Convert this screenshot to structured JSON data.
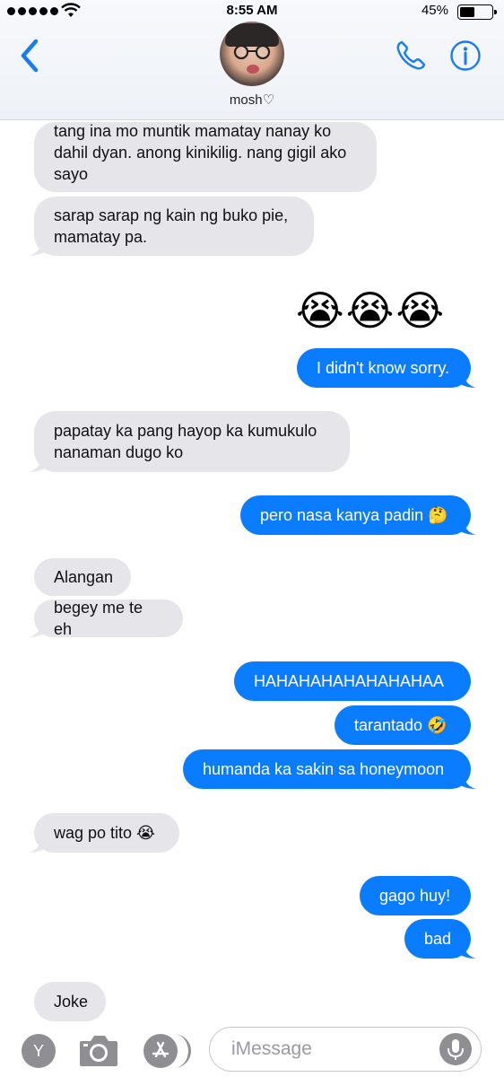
{
  "status_bar": {
    "time": "8:55 AM",
    "battery_percent": "45%",
    "battery_level": 0.45,
    "signal_bars": 5
  },
  "contact": {
    "name": "mosh♡"
  },
  "messages": [
    {
      "side": "in",
      "text": "tang ina mo muntik mamatay nanay ko dahil dyan. anong kinikilig. nang gigil ako sayo"
    },
    {
      "side": "in",
      "text": "sarap sarap ng kain ng buko pie, mamatay pa."
    },
    {
      "side": "out",
      "text": "😭😭😭",
      "kind": "big-emoji"
    },
    {
      "side": "out",
      "text": "I didn't know sorry."
    },
    {
      "side": "in",
      "text": "papatay ka pang hayop ka kumukulo nanaman dugo ko"
    },
    {
      "side": "out",
      "text": "pero nasa kanya padin 🤔"
    },
    {
      "side": "in",
      "text": "Alangan"
    },
    {
      "side": "in",
      "text": "begey me te eh"
    },
    {
      "side": "out",
      "text": "HAHAHAHAHAHAHAHAA"
    },
    {
      "side": "out",
      "text": "tarantado 🤣"
    },
    {
      "side": "out",
      "text": "humanda ka sakin sa honeymoon"
    },
    {
      "side": "in",
      "text": "wag po tito 😭"
    },
    {
      "side": "out",
      "text": "gago huy!"
    },
    {
      "side": "out",
      "text": "bad"
    },
    {
      "side": "in",
      "text": "Joke"
    }
  ],
  "input_bar": {
    "placeholder": "iMessage",
    "apps_button_label": "Y",
    "icons": [
      "camera-icon",
      "app-store-icon",
      "microphone-icon"
    ]
  },
  "colors": {
    "outgoing": "#0a7cff",
    "incoming": "#e5e5ea",
    "accent": "#1a7cf5"
  }
}
